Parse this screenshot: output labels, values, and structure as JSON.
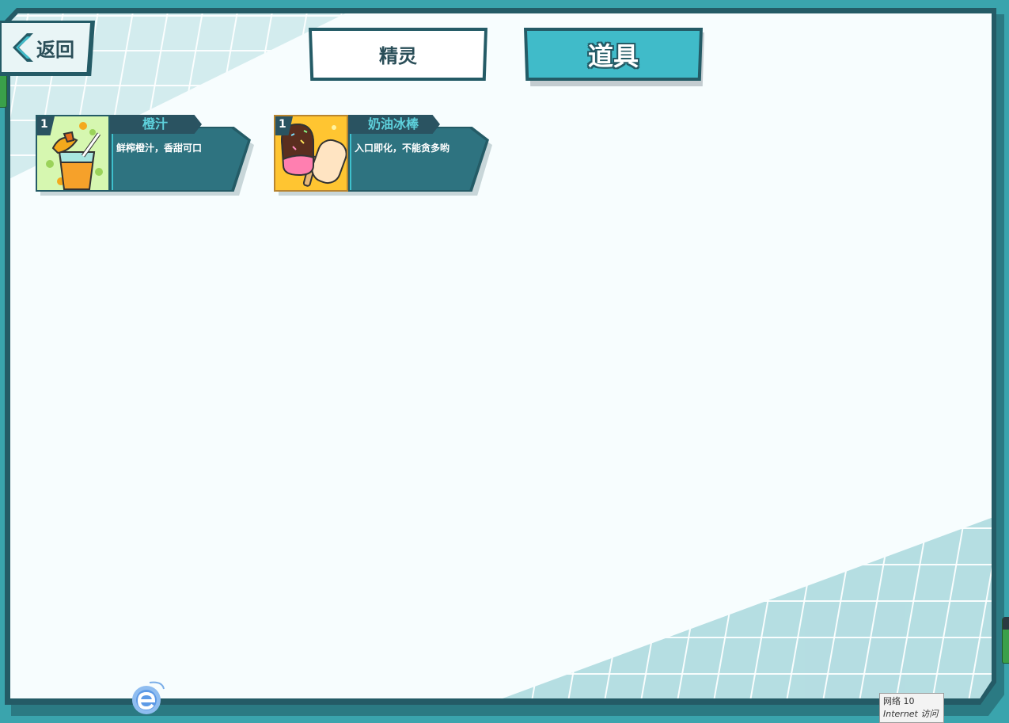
{
  "back_button": {
    "label": "返回"
  },
  "tabs": [
    {
      "label": "精灵",
      "active": false
    },
    {
      "label": "道具",
      "active": true
    }
  ],
  "items": [
    {
      "count": "1",
      "name": "橙汁",
      "description": "鲜榨橙汁，香甜可口",
      "icon": "orange-juice-icon"
    },
    {
      "count": "1",
      "name": "奶油冰棒",
      "description": "入口即化，不能贪多哟",
      "icon": "cream-popsicle-icon"
    }
  ],
  "status_tooltip": {
    "line1": "网络  10",
    "line2": "Internet 访问"
  },
  "colors": {
    "frame": "#245b66",
    "accent": "#40bbc9",
    "card_body": "#2e7380",
    "item_name": "#5ed1dc"
  }
}
